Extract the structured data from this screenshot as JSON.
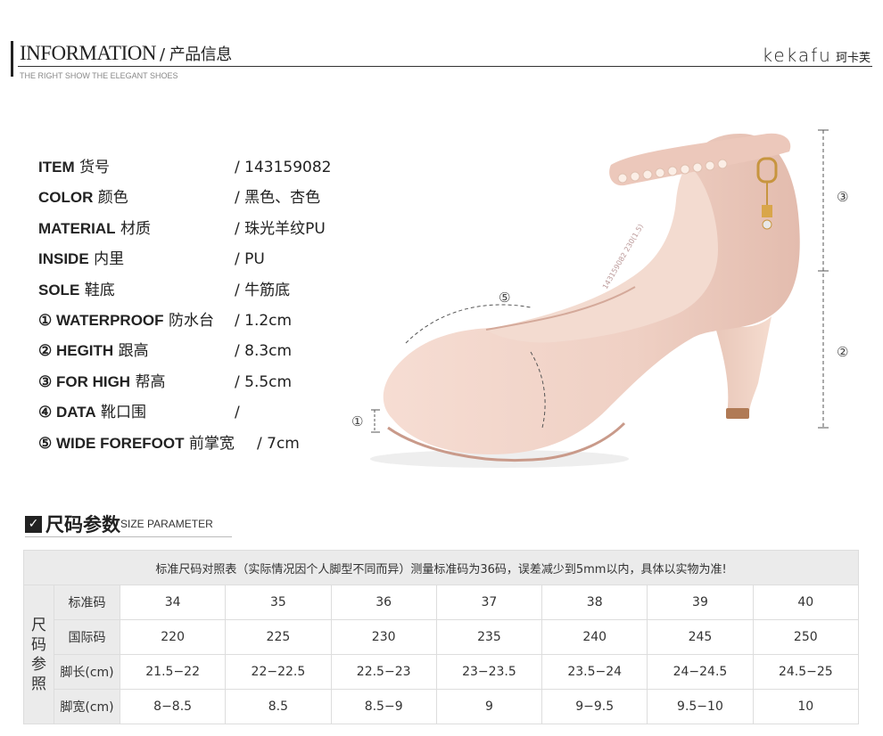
{
  "header": {
    "title_en": "INFORMATION",
    "title_cn": "/ 产品信息",
    "subtitle": "THE RIGHT SHOW THE ELEGANT SHOES",
    "brand_logo": "kekafu",
    "brand_cn": "珂卡芙"
  },
  "specs": [
    {
      "label": "ITEM",
      "cn": " 货号",
      "value": "/ 143159082"
    },
    {
      "label": "COLOR",
      "cn": " 颜色",
      "value": "/ 黑色、杏色"
    },
    {
      "label": "MATERIAL",
      "cn": " 材质",
      "value": "/ 珠光羊纹PU"
    },
    {
      "label": "INSIDE",
      "cn": " 内里",
      "value": "/ PU"
    },
    {
      "label": "SOLE",
      "cn": " 鞋底",
      "value": "/ 牛筋底"
    },
    {
      "label": "① WATERPROOF",
      "cn": " 防水台",
      "value": "/ 1.2cm"
    },
    {
      "label": "② HEGITH",
      "cn": " 跟高",
      "value": "/ 8.3cm"
    },
    {
      "label": "③ FOR HIGH",
      "cn": "  帮高",
      "value": "/ 5.5cm"
    },
    {
      "label": "④ DATA",
      "cn": "  靴口围",
      "value": "/"
    },
    {
      "label": "⑤  WIDE FOREFOOT",
      "cn": " 前掌宽",
      "value": "/ 7cm"
    }
  ],
  "shoe": {
    "marker1": "①",
    "marker2": "②",
    "marker3": "③",
    "marker5": "⑤",
    "insole_text": "143159082 230(1.5)"
  },
  "size_section": {
    "check_icon": "check-icon",
    "title_cn": "尺码参数",
    "title_en": "SIZE PARAMETER",
    "note": "标准尺码对照表（实际情况因个人脚型不同而异）测量标准码为36码，误差减少到5mm以内，具体以实物为准!",
    "side_label": [
      "尺",
      "码",
      "参",
      "照"
    ],
    "rows": [
      {
        "label": "标准码",
        "values": [
          "34",
          "35",
          "36",
          "37",
          "38",
          "39",
          "40"
        ]
      },
      {
        "label": "国际码",
        "values": [
          "220",
          "225",
          "230",
          "235",
          "240",
          "245",
          "250"
        ]
      },
      {
        "label": "脚长(cm)",
        "values": [
          "21.5−22",
          "22−22.5",
          "22.5−23",
          "23−23.5",
          "23.5−24",
          "24−24.5",
          "24.5−25"
        ]
      },
      {
        "label": "脚宽(cm)",
        "values": [
          "8−8.5",
          "8.5",
          "8.5−9",
          "9",
          "9−9.5",
          "9.5−10",
          "10"
        ]
      }
    ]
  },
  "colors": {
    "shoe": "#f0d3c8",
    "shoe_shadow": "#d9b3a5",
    "table_bg": "#ebebeb"
  }
}
